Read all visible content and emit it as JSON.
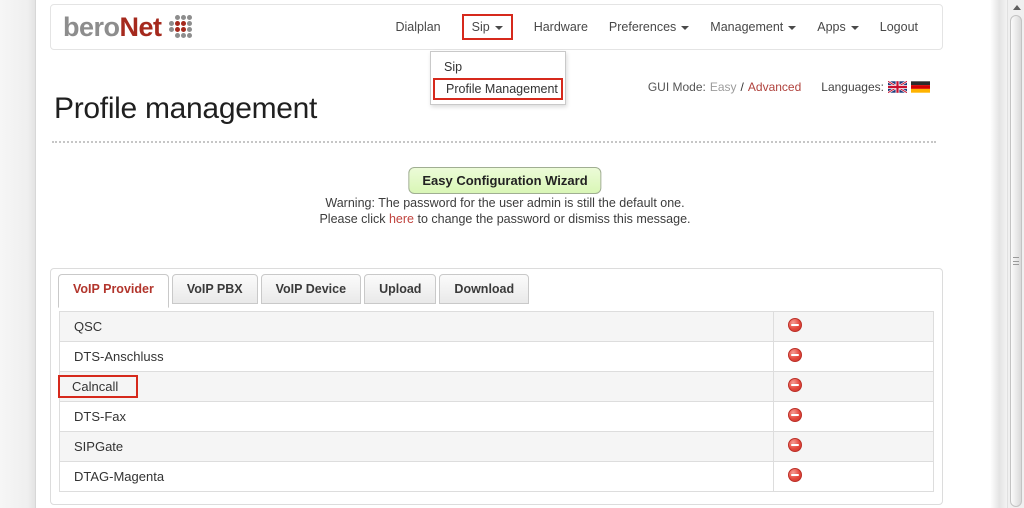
{
  "brand": {
    "bero": "bero",
    "net": "Net"
  },
  "navbar": {
    "items": [
      {
        "label": "Dialplan",
        "has_dropdown": false,
        "highlighted": false
      },
      {
        "label": "Sip",
        "has_dropdown": true,
        "highlighted": true
      },
      {
        "label": "Hardware",
        "has_dropdown": false,
        "highlighted": false
      },
      {
        "label": "Preferences",
        "has_dropdown": true,
        "highlighted": false
      },
      {
        "label": "Management",
        "has_dropdown": true,
        "highlighted": false
      },
      {
        "label": "Apps",
        "has_dropdown": true,
        "highlighted": false
      },
      {
        "label": "Logout",
        "has_dropdown": false,
        "highlighted": false
      }
    ]
  },
  "sip_dropdown": {
    "items": [
      {
        "label": "Sip",
        "highlighted": false
      },
      {
        "label": "Profile Management",
        "highlighted": true
      }
    ]
  },
  "header": {
    "gui_mode_label": "GUI Mode:",
    "gui_mode_easy": "Easy",
    "gui_mode_separator": "/",
    "gui_mode_advanced": "Advanced",
    "languages_label": "Languages:",
    "language_flags": [
      "uk-flag",
      "german-flag"
    ]
  },
  "page": {
    "title": "Profile management"
  },
  "wizard": {
    "label": "Easy Configuration Wizard"
  },
  "warning": {
    "line1": "Warning: The password for the user admin is still the default one.",
    "line2_before_link": "Please click",
    "line2_link": "here",
    "line2_after_link": "to change the password or dismiss this message."
  },
  "tabs": [
    {
      "label": "VoIP Provider",
      "active": true
    },
    {
      "label": "VoIP PBX",
      "active": false
    },
    {
      "label": "VoIP Device",
      "active": false
    },
    {
      "label": "Upload",
      "active": false
    },
    {
      "label": "Download",
      "active": false
    }
  ],
  "profiles": [
    {
      "name": "QSC",
      "highlighted": false
    },
    {
      "name": "DTS-Anschluss",
      "highlighted": false
    },
    {
      "name": "Calncall",
      "highlighted": true
    },
    {
      "name": "DTS-Fax",
      "highlighted": false
    },
    {
      "name": "SIPGate",
      "highlighted": false
    },
    {
      "name": "DTAG-Magenta",
      "highlighted": false
    }
  ],
  "icons": {
    "row_action": "minus-circle-icon",
    "nav_caret": "chevron-down-icon",
    "scrollbar_up": "scroll-up-arrow-icon"
  },
  "colors": {
    "brand_red": "#a5291d",
    "brand_gray": "#8d8d8d",
    "highlight_box_red": "#d6291c",
    "link_red": "#b0423d",
    "active_tab_red": "#b2352c",
    "delete_icon_red": "#e4473c",
    "wizard_green_bg": "#ddf7bd",
    "row_stripe_gray": "#f5f5f5"
  }
}
